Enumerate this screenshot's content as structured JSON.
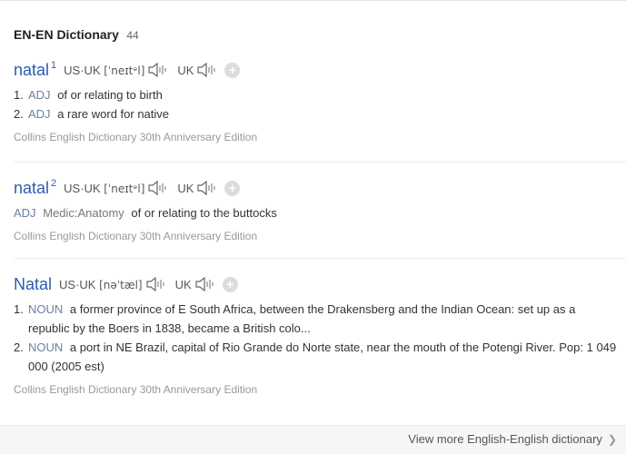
{
  "header": {
    "title": "EN-EN Dictionary",
    "count": "44"
  },
  "entries": [
    {
      "word": "natal",
      "sup": "1",
      "pron": {
        "label": "US·UK",
        "phonetic": "[ˈneɪtᵊl]",
        "uk_label": "UK"
      },
      "defs": [
        {
          "num": "1.",
          "pos": "ADJ",
          "text": "of or relating to birth"
        },
        {
          "num": "2.",
          "pos": "ADJ",
          "text": "a rare word for native"
        }
      ],
      "source": "Collins English Dictionary 30th Anniversary Edition"
    },
    {
      "word": "natal",
      "sup": "2",
      "pron": {
        "label": "US·UK",
        "phonetic": "[ˈneɪtᵊl]",
        "uk_label": "UK"
      },
      "single": {
        "pos": "ADJ",
        "domain": "Medic:Anatomy",
        "text": "of or relating to the buttocks"
      },
      "source": "Collins English Dictionary 30th Anniversary Edition"
    },
    {
      "word": "Natal",
      "sup": "",
      "pron": {
        "label": "US·UK",
        "phonetic": "[nəˈtæl]",
        "uk_label": "UK"
      },
      "defs": [
        {
          "num": "1.",
          "pos": "NOUN",
          "text": "a former province of E South Africa, between the Drakensberg and the Indian Ocean: set up as a republic by the Boers in 1838, became a British colo..."
        },
        {
          "num": "2.",
          "pos": "NOUN",
          "text": "a port in NE Brazil, capital of Rio Grande do Norte state, near the mouth of the Potengi River. Pop: 1 049 000 (2005 est)"
        }
      ],
      "source": "Collins English Dictionary 30th Anniversary Edition"
    }
  ],
  "footer": {
    "more_label": "View more English-English dictionary",
    "chevron_icon": "chevron-right-icon"
  },
  "icons": {
    "speaker": "speaker-icon",
    "add": "plus-icon"
  },
  "colors": {
    "word": "#2a5db0",
    "pos": "#6a7fa3",
    "source": "#999999"
  }
}
